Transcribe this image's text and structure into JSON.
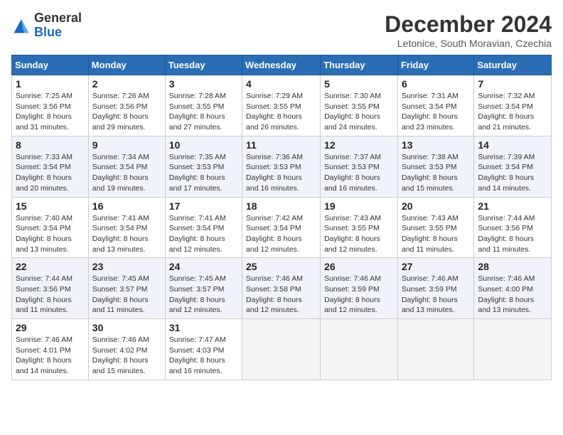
{
  "logo": {
    "general": "General",
    "blue": "Blue"
  },
  "header": {
    "title": "December 2024",
    "location": "Letonice, South Moravian, Czechia"
  },
  "weekdays": [
    "Sunday",
    "Monday",
    "Tuesday",
    "Wednesday",
    "Thursday",
    "Friday",
    "Saturday"
  ],
  "weeks": [
    [
      {
        "day": "1",
        "sunrise": "Sunrise: 7:25 AM",
        "sunset": "Sunset: 3:56 PM",
        "daylight": "Daylight: 8 hours and 31 minutes."
      },
      {
        "day": "2",
        "sunrise": "Sunrise: 7:26 AM",
        "sunset": "Sunset: 3:56 PM",
        "daylight": "Daylight: 8 hours and 29 minutes."
      },
      {
        "day": "3",
        "sunrise": "Sunrise: 7:28 AM",
        "sunset": "Sunset: 3:55 PM",
        "daylight": "Daylight: 8 hours and 27 minutes."
      },
      {
        "day": "4",
        "sunrise": "Sunrise: 7:29 AM",
        "sunset": "Sunset: 3:55 PM",
        "daylight": "Daylight: 8 hours and 26 minutes."
      },
      {
        "day": "5",
        "sunrise": "Sunrise: 7:30 AM",
        "sunset": "Sunset: 3:55 PM",
        "daylight": "Daylight: 8 hours and 24 minutes."
      },
      {
        "day": "6",
        "sunrise": "Sunrise: 7:31 AM",
        "sunset": "Sunset: 3:54 PM",
        "daylight": "Daylight: 8 hours and 23 minutes."
      },
      {
        "day": "7",
        "sunrise": "Sunrise: 7:32 AM",
        "sunset": "Sunset: 3:54 PM",
        "daylight": "Daylight: 8 hours and 21 minutes."
      }
    ],
    [
      {
        "day": "8",
        "sunrise": "Sunrise: 7:33 AM",
        "sunset": "Sunset: 3:54 PM",
        "daylight": "Daylight: 8 hours and 20 minutes."
      },
      {
        "day": "9",
        "sunrise": "Sunrise: 7:34 AM",
        "sunset": "Sunset: 3:54 PM",
        "daylight": "Daylight: 8 hours and 19 minutes."
      },
      {
        "day": "10",
        "sunrise": "Sunrise: 7:35 AM",
        "sunset": "Sunset: 3:53 PM",
        "daylight": "Daylight: 8 hours and 17 minutes."
      },
      {
        "day": "11",
        "sunrise": "Sunrise: 7:36 AM",
        "sunset": "Sunset: 3:53 PM",
        "daylight": "Daylight: 8 hours and 16 minutes."
      },
      {
        "day": "12",
        "sunrise": "Sunrise: 7:37 AM",
        "sunset": "Sunset: 3:53 PM",
        "daylight": "Daylight: 8 hours and 16 minutes."
      },
      {
        "day": "13",
        "sunrise": "Sunrise: 7:38 AM",
        "sunset": "Sunset: 3:53 PM",
        "daylight": "Daylight: 8 hours and 15 minutes."
      },
      {
        "day": "14",
        "sunrise": "Sunrise: 7:39 AM",
        "sunset": "Sunset: 3:54 PM",
        "daylight": "Daylight: 8 hours and 14 minutes."
      }
    ],
    [
      {
        "day": "15",
        "sunrise": "Sunrise: 7:40 AM",
        "sunset": "Sunset: 3:54 PM",
        "daylight": "Daylight: 8 hours and 13 minutes."
      },
      {
        "day": "16",
        "sunrise": "Sunrise: 7:41 AM",
        "sunset": "Sunset: 3:54 PM",
        "daylight": "Daylight: 8 hours and 13 minutes."
      },
      {
        "day": "17",
        "sunrise": "Sunrise: 7:41 AM",
        "sunset": "Sunset: 3:54 PM",
        "daylight": "Daylight: 8 hours and 12 minutes."
      },
      {
        "day": "18",
        "sunrise": "Sunrise: 7:42 AM",
        "sunset": "Sunset: 3:54 PM",
        "daylight": "Daylight: 8 hours and 12 minutes."
      },
      {
        "day": "19",
        "sunrise": "Sunrise: 7:43 AM",
        "sunset": "Sunset: 3:55 PM",
        "daylight": "Daylight: 8 hours and 12 minutes."
      },
      {
        "day": "20",
        "sunrise": "Sunrise: 7:43 AM",
        "sunset": "Sunset: 3:55 PM",
        "daylight": "Daylight: 8 hours and 11 minutes."
      },
      {
        "day": "21",
        "sunrise": "Sunrise: 7:44 AM",
        "sunset": "Sunset: 3:56 PM",
        "daylight": "Daylight: 8 hours and 11 minutes."
      }
    ],
    [
      {
        "day": "22",
        "sunrise": "Sunrise: 7:44 AM",
        "sunset": "Sunset: 3:56 PM",
        "daylight": "Daylight: 8 hours and 11 minutes."
      },
      {
        "day": "23",
        "sunrise": "Sunrise: 7:45 AM",
        "sunset": "Sunset: 3:57 PM",
        "daylight": "Daylight: 8 hours and 11 minutes."
      },
      {
        "day": "24",
        "sunrise": "Sunrise: 7:45 AM",
        "sunset": "Sunset: 3:57 PM",
        "daylight": "Daylight: 8 hours and 12 minutes."
      },
      {
        "day": "25",
        "sunrise": "Sunrise: 7:46 AM",
        "sunset": "Sunset: 3:58 PM",
        "daylight": "Daylight: 8 hours and 12 minutes."
      },
      {
        "day": "26",
        "sunrise": "Sunrise: 7:46 AM",
        "sunset": "Sunset: 3:59 PM",
        "daylight": "Daylight: 8 hours and 12 minutes."
      },
      {
        "day": "27",
        "sunrise": "Sunrise: 7:46 AM",
        "sunset": "Sunset: 3:59 PM",
        "daylight": "Daylight: 8 hours and 13 minutes."
      },
      {
        "day": "28",
        "sunrise": "Sunrise: 7:46 AM",
        "sunset": "Sunset: 4:00 PM",
        "daylight": "Daylight: 8 hours and 13 minutes."
      }
    ],
    [
      {
        "day": "29",
        "sunrise": "Sunrise: 7:46 AM",
        "sunset": "Sunset: 4:01 PM",
        "daylight": "Daylight: 8 hours and 14 minutes."
      },
      {
        "day": "30",
        "sunrise": "Sunrise: 7:46 AM",
        "sunset": "Sunset: 4:02 PM",
        "daylight": "Daylight: 8 hours and 15 minutes."
      },
      {
        "day": "31",
        "sunrise": "Sunrise: 7:47 AM",
        "sunset": "Sunset: 4:03 PM",
        "daylight": "Daylight: 8 hours and 16 minutes."
      },
      null,
      null,
      null,
      null
    ]
  ]
}
